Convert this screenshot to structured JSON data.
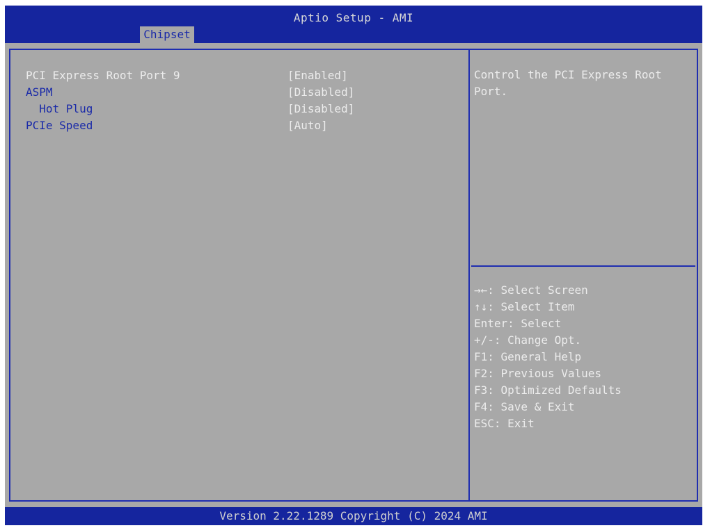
{
  "header": {
    "title": "Aptio Setup - AMI",
    "tab": "Chipset"
  },
  "settings": [
    {
      "label": "PCI Express Root Port 9",
      "value": "[Enabled]"
    },
    {
      "label": "ASPM",
      "value": "[Disabled]"
    },
    {
      "label": "  Hot Plug",
      "value": "[Disabled]"
    },
    {
      "label": "PCIe Speed",
      "value": "[Auto]"
    }
  ],
  "help": {
    "line1": "Control the PCI Express Root",
    "line2": "Port."
  },
  "keys": [
    "→←: Select Screen",
    "↑↓: Select Item",
    "Enter: Select",
    "+/-: Change Opt.",
    "F1: General Help",
    "F2: Previous Values",
    "F3: Optimized Defaults",
    "F4: Save & Exit",
    "ESC: Exit"
  ],
  "footer": "Version 2.22.1289 Copyright (C) 2024 AMI",
  "colors": {
    "header_blue": "#15259e",
    "panel_gray": "#a8a8a8",
    "label_blue": "#1a2aa8",
    "highlight_white": "#ececec"
  }
}
